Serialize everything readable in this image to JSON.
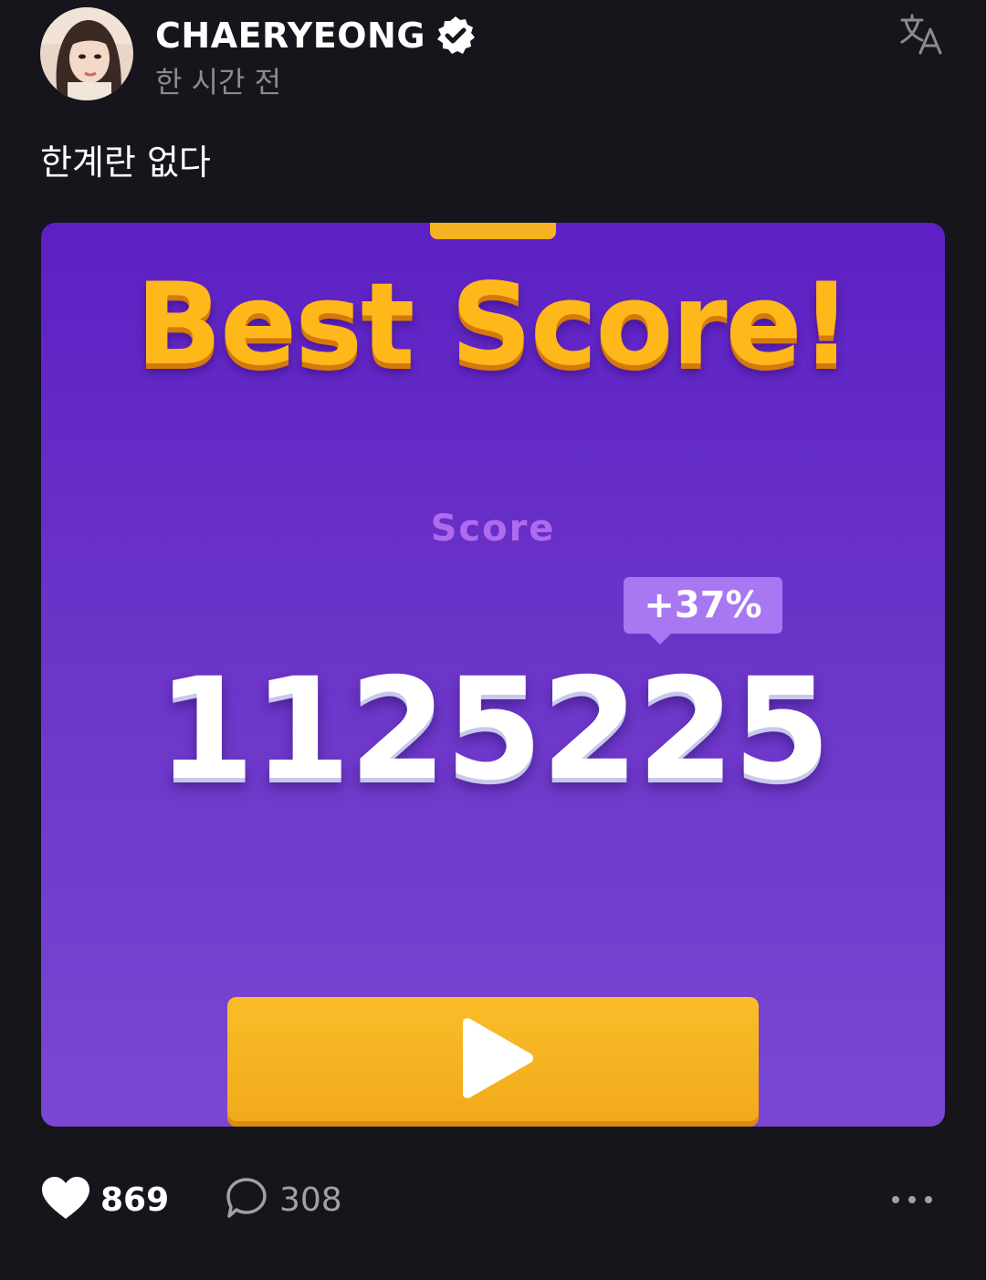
{
  "post": {
    "author": "CHAERYEONG",
    "time": "한 시간 전",
    "caption": "한계란 없다"
  },
  "media": {
    "title": "Best Score!",
    "score_label": "Score",
    "percent_badge": "+37%",
    "score_value": "1125225",
    "colors": {
      "background": "#6a34c8",
      "title": "#ffb81a",
      "button": "#f5b321"
    }
  },
  "actions": {
    "likes": "869",
    "comments": "308"
  },
  "icons": {
    "verified": "verified-badge-icon",
    "translate": "translate-icon",
    "play": "play-icon",
    "like": "heart-icon",
    "comment": "comment-bubble-icon",
    "more": "more-dots-icon"
  }
}
